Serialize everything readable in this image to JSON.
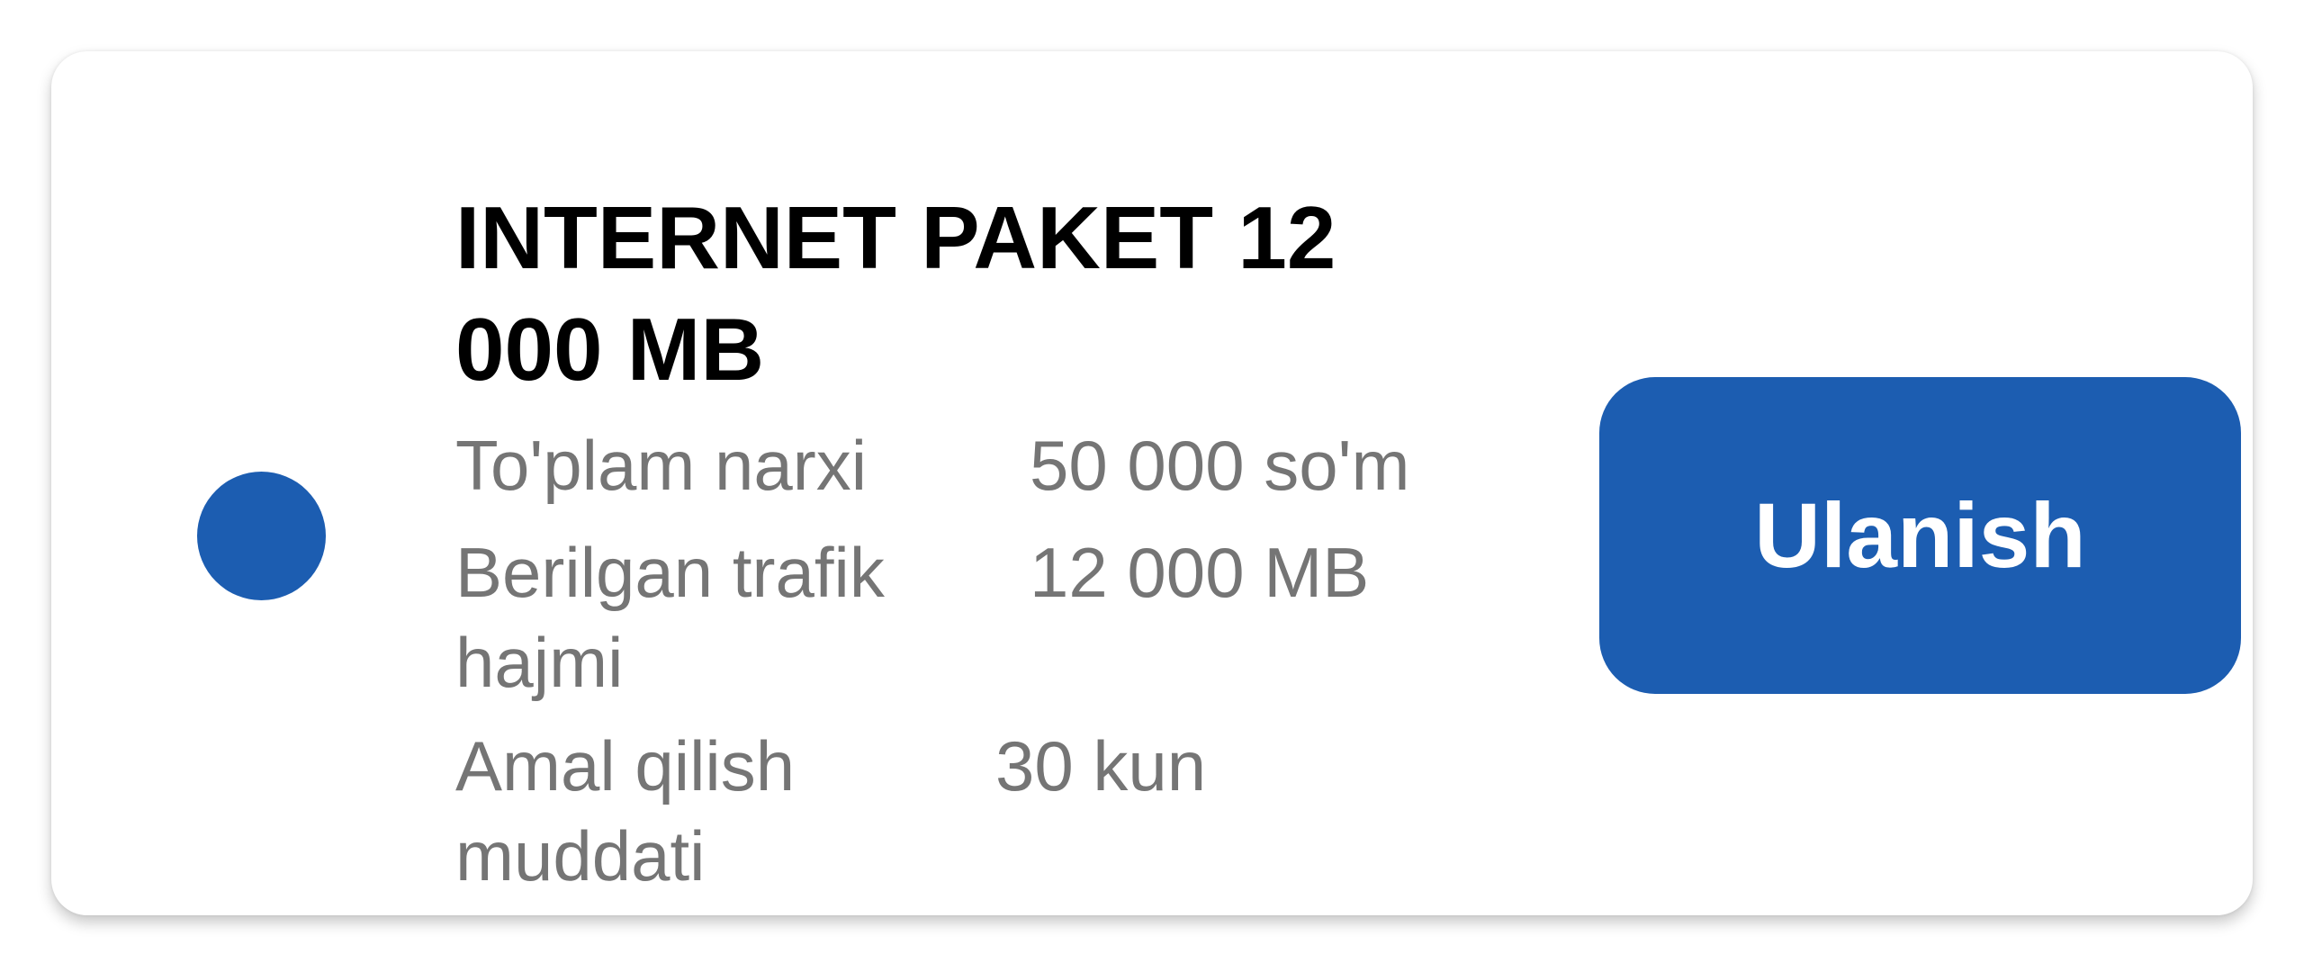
{
  "package": {
    "title": "INTERNET PAKET 12 000 MB",
    "details": [
      {
        "label_lines": [
          "To'plam narxi"
        ],
        "value": "50 000 so'm"
      },
      {
        "label_lines": [
          "Berilgan trafik",
          "hajmi"
        ],
        "value": "12 000 MB"
      },
      {
        "label_lines": [
          "Amal qilish",
          "muddati"
        ],
        "value": "30 kun"
      }
    ],
    "connect_label": "Ulanish",
    "accent_color": "#1c5db1",
    "selector_icon": "radio-dot-icon"
  }
}
